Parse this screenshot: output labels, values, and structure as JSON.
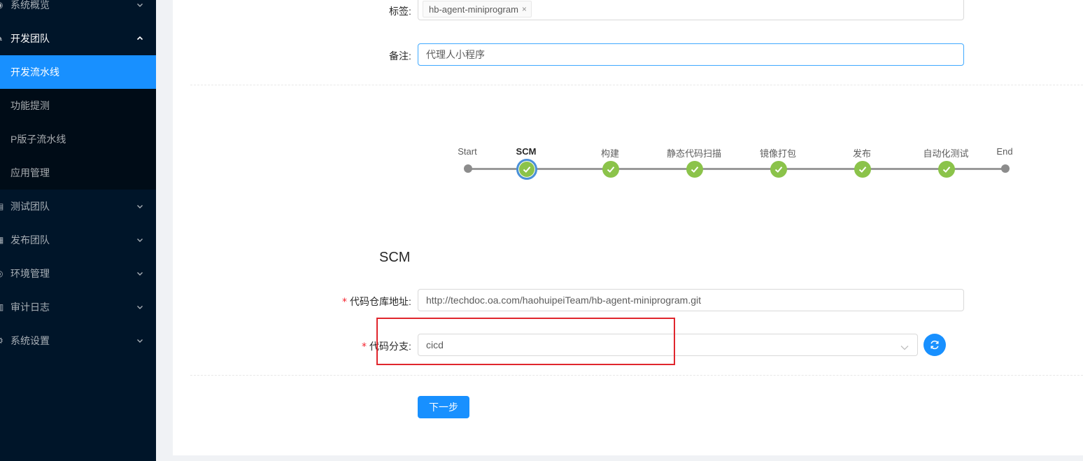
{
  "sidebar": {
    "items": [
      {
        "label": "系统概览",
        "icon": "dashboard-icon",
        "arrow": "chevron-down"
      },
      {
        "label": "开发团队",
        "icon": "code-icon",
        "arrow": "chevron-up"
      },
      {
        "label": "开发流水线"
      },
      {
        "label": "功能提测"
      },
      {
        "label": "P版子流水线"
      },
      {
        "label": "应用管理"
      },
      {
        "label": "测试团队",
        "icon": "test-icon",
        "arrow": "chevron-down"
      },
      {
        "label": "发布团队",
        "icon": "calendar-icon",
        "arrow": "chevron-down"
      },
      {
        "label": "环境管理",
        "icon": "setting-icon",
        "arrow": "chevron-down"
      },
      {
        "label": "审计日志",
        "icon": "audit-icon",
        "arrow": "chevron-down"
      },
      {
        "label": "系统设置",
        "icon": "gear-icon",
        "arrow": "chevron-down"
      }
    ],
    "colors": {
      "bg": "#001529",
      "submenu_bg": "#000c17",
      "selected": "#1890ff"
    }
  },
  "form": {
    "tags_label": "标签:",
    "tag_value": "hb-agent-miniprogram",
    "tag_close": "×",
    "note_label": "备注:",
    "note_value": "代理人小程序"
  },
  "pipeline": {
    "steps": [
      {
        "label": "Start",
        "status": "dot"
      },
      {
        "label": "SCM",
        "status": "active"
      },
      {
        "label": "构建",
        "status": "done"
      },
      {
        "label": "静态代码扫描",
        "status": "done"
      },
      {
        "label": "镜像打包",
        "status": "done"
      },
      {
        "label": "发布",
        "status": "done"
      },
      {
        "label": "自动化测试",
        "status": "done"
      },
      {
        "label": "End",
        "status": "dot"
      }
    ]
  },
  "scm": {
    "title": "SCM",
    "repo_label": "代码仓库地址:",
    "repo_value": "http://techdoc.oa.com/haohuipeiTeam/hb-agent-miniprogram.git",
    "branch_label": "代码分支:",
    "branch_value": "cicd",
    "required_mark": "*"
  },
  "actions": {
    "next_label": "下一步"
  },
  "colors": {
    "primary": "#1890ff",
    "step_done": "#8bc34a",
    "highlight": "#e0262d"
  }
}
